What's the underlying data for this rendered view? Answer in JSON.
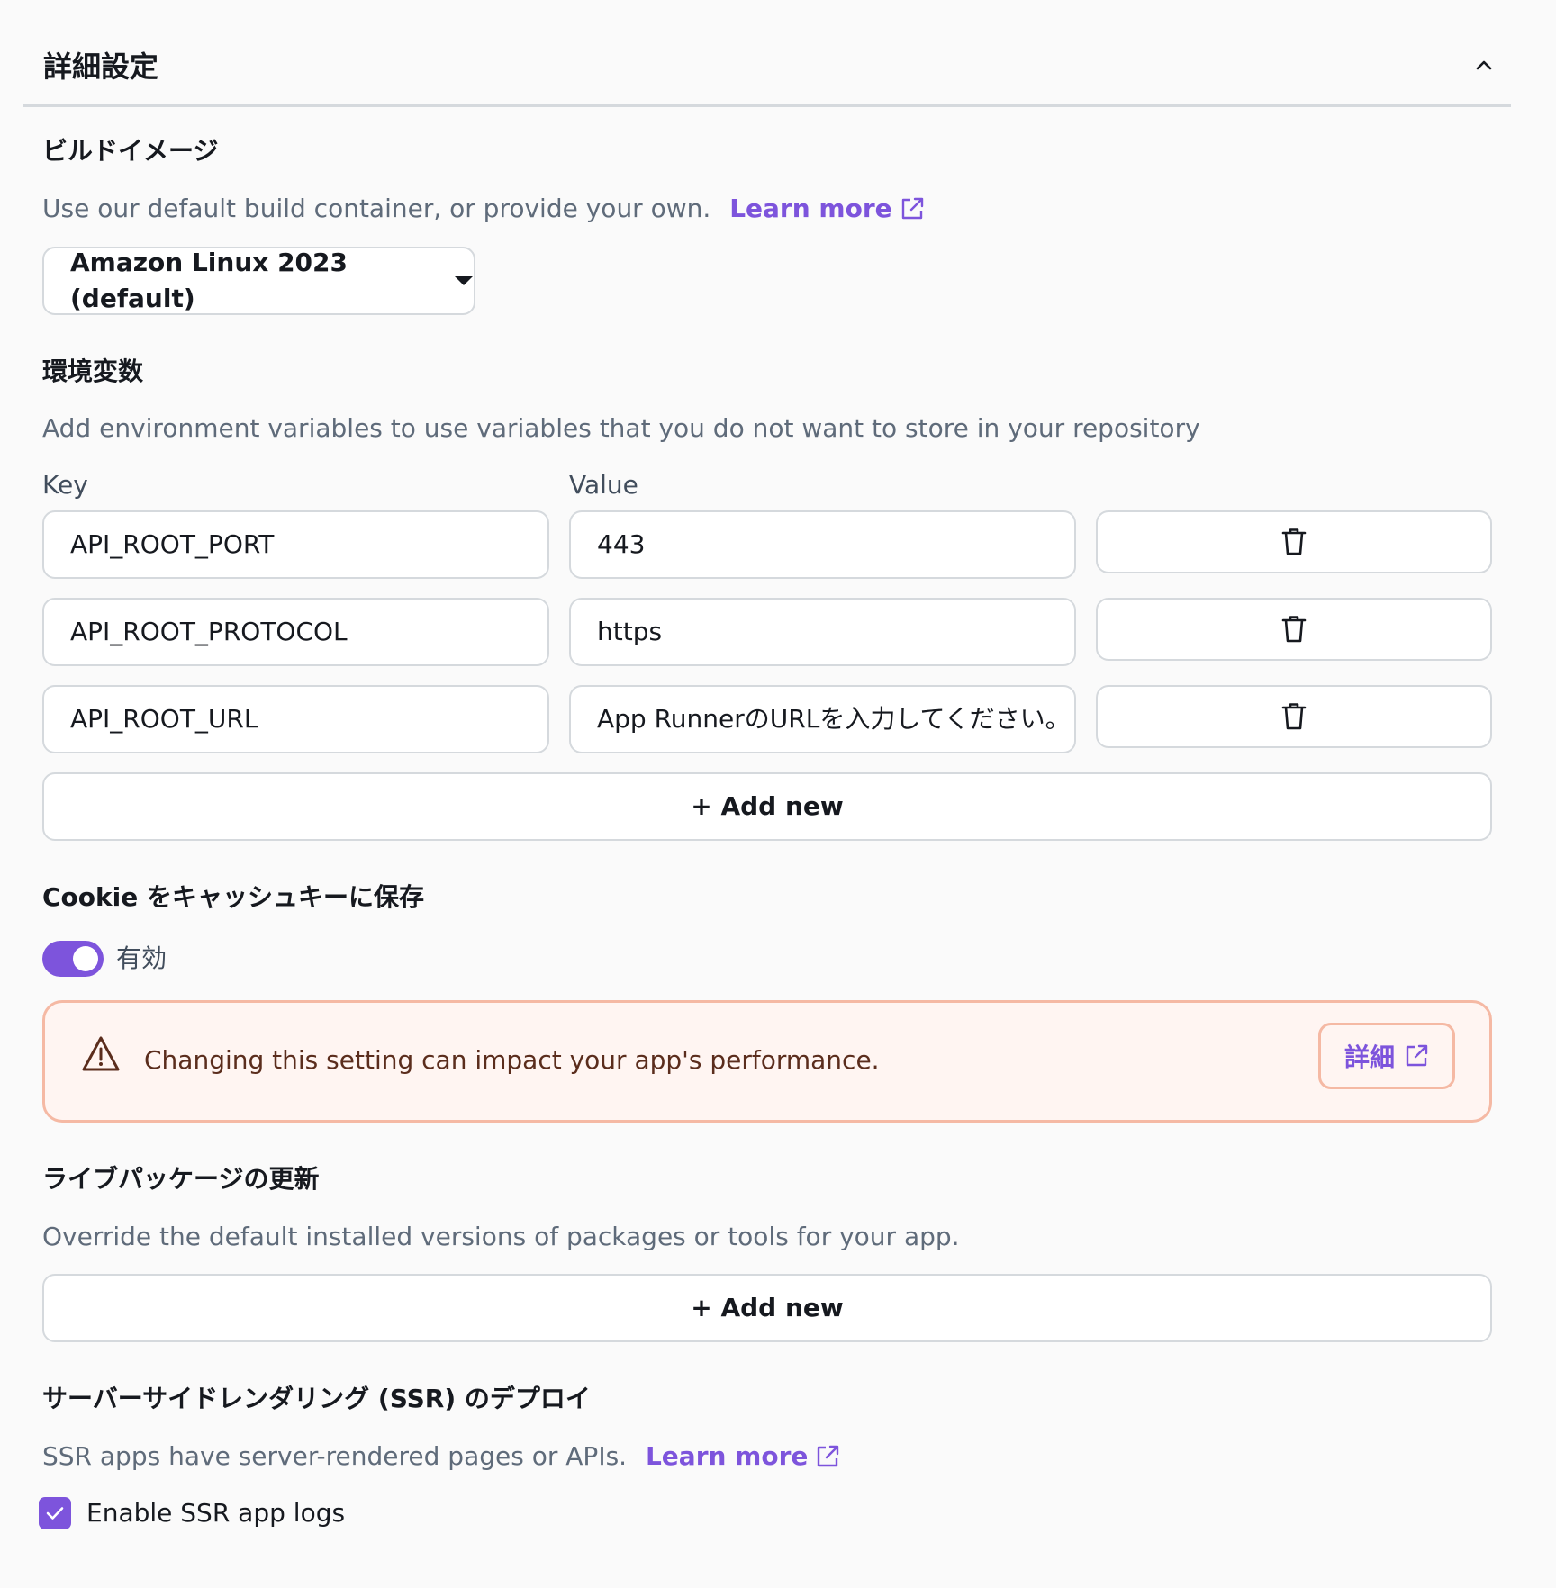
{
  "header": {
    "title": "詳細設定"
  },
  "build_image": {
    "title": "ビルドイメージ",
    "description": "Use our default build container, or provide your own.",
    "learn_more": "Learn more",
    "selected": "Amazon Linux 2023 (default)"
  },
  "env_vars": {
    "title": "環境変数",
    "description": "Add environment variables to use variables that you do not want to store in your repository",
    "key_label": "Key",
    "value_label": "Value",
    "rows": [
      {
        "key": "API_ROOT_PORT",
        "value": "443"
      },
      {
        "key": "API_ROOT_PROTOCOL",
        "value": "https"
      },
      {
        "key": "API_ROOT_URL",
        "value": "App RunnerのURLを入力してください。"
      }
    ],
    "add_new": "+ Add new"
  },
  "cookie_cache": {
    "title": "Cookie をキャッシュキーに保存",
    "toggle_label": "有効",
    "toggle_on": true,
    "alert_text": "Changing this setting can impact your app's performance.",
    "alert_button": "詳細"
  },
  "live_packages": {
    "title": "ライブパッケージの更新",
    "description": "Override the default installed versions of packages or tools for your app.",
    "add_new": "+ Add new"
  },
  "ssr": {
    "title": "サーバーサイドレンダリング (SSR) のデプロイ",
    "description": "SSR apps have server-rendered pages or APIs.",
    "learn_more": "Learn more",
    "checkbox_label": "Enable SSR app logs",
    "checkbox_checked": true
  },
  "colors": {
    "accent": "#7d54dc",
    "alert_border": "#f5b9a4",
    "alert_bg": "#fff5f2",
    "background": "#fafafa"
  }
}
